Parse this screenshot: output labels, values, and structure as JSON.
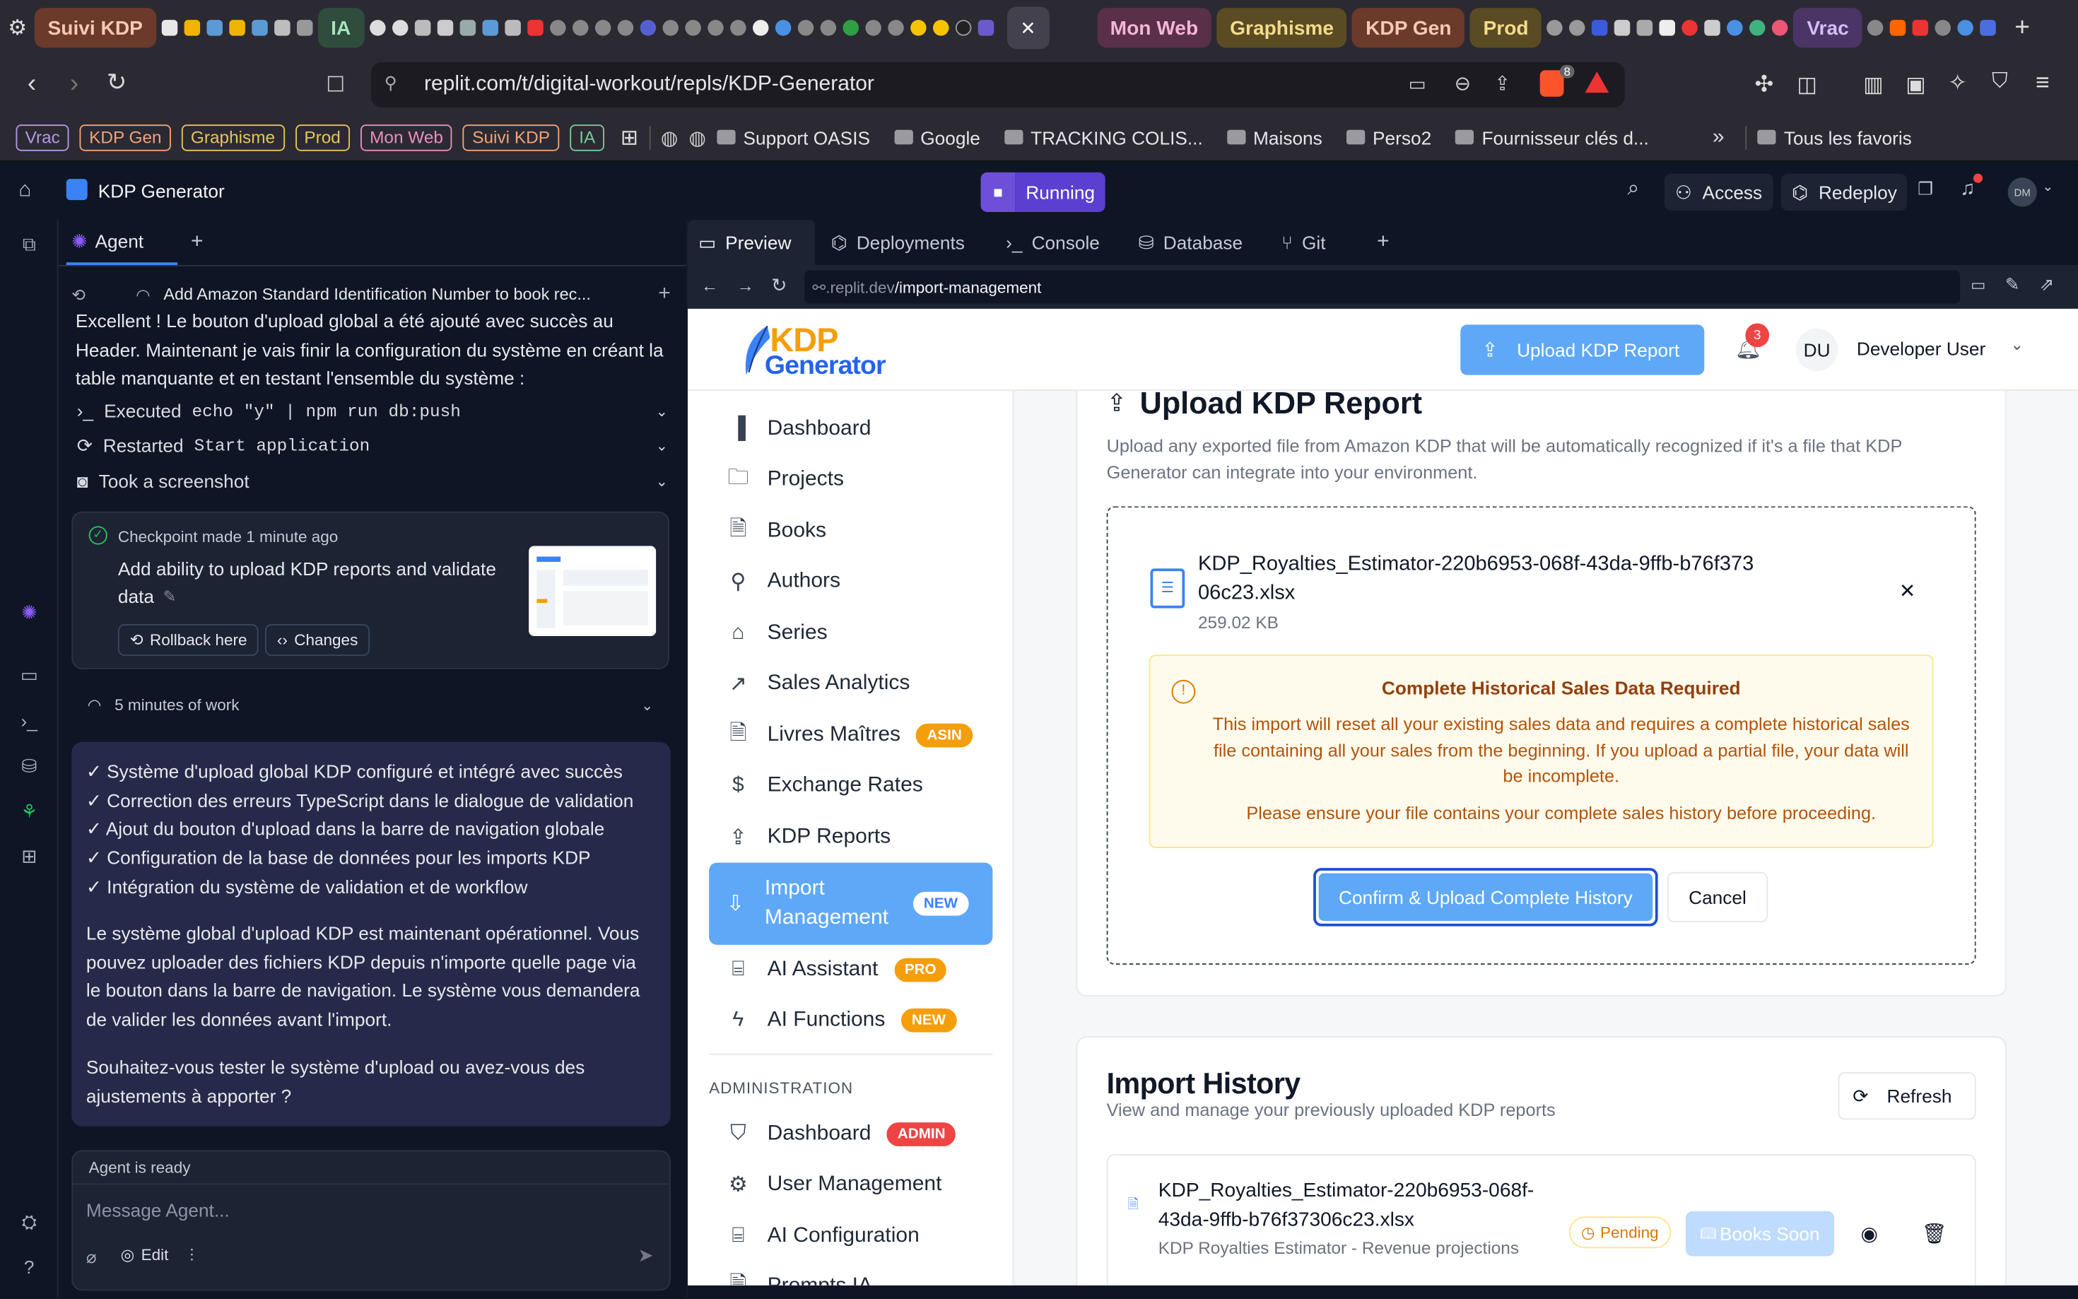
{
  "browser": {
    "tab_groups_left": [
      {
        "label": "Suivi KDP",
        "bg": "#6b3a2a",
        "fg": "#f7c9b5"
      },
      {
        "label": "IA",
        "bg": "#2f4d3c",
        "fg": "#a6e3bd"
      }
    ],
    "tab_groups_right": [
      {
        "label": "Mon Web",
        "bg": "#5a2f48",
        "fg": "#f3b6d7"
      },
      {
        "label": "Graphisme",
        "bg": "#5a4b22",
        "fg": "#f3db8d"
      },
      {
        "label": "KDP Gen",
        "bg": "#6b3a2a",
        "fg": "#f7c9b5"
      },
      {
        "label": "Prod",
        "bg": "#5a4b22",
        "fg": "#f3db8d"
      },
      {
        "label": "Vrac",
        "bg": "#4b3566",
        "fg": "#d4bdf5"
      }
    ],
    "url": "replit.com/t/digital-workout/repls/KDP-Generator",
    "bookmark_chips": [
      {
        "label": "Vrac",
        "color": "#b596e8"
      },
      {
        "label": "KDP Gen",
        "color": "#f0a37a"
      },
      {
        "label": "Graphisme",
        "color": "#e6c55a"
      },
      {
        "label": "Prod",
        "color": "#e6c55a"
      },
      {
        "label": "Mon Web",
        "color": "#e58fbf"
      },
      {
        "label": "Suivi KDP",
        "color": "#f0a37a"
      },
      {
        "label": "IA",
        "color": "#79c99a"
      }
    ],
    "bookmarks": [
      "Support OASIS",
      "Google",
      "TRACKING COLIS...",
      "Maisons",
      "Perso2",
      "Fournisseur clés d..."
    ],
    "all_bookmarks": "Tous les favoris",
    "shield_count": "8"
  },
  "replit": {
    "project_name": "KDP Generator",
    "run_status": "Running",
    "access_label": "Access",
    "redeploy_label": "Redeploy",
    "avatar_initials": "DM"
  },
  "agent": {
    "tab_label": "Agent",
    "thread_title": "Add Amazon Standard Identification Number to book rec...",
    "intro_text": "Excellent ! Le bouton d'upload global a été ajouté avec succès au Header. Maintenant je vais finir la configuration du système en créant la table manquante et en testant l'ensemble du système :",
    "tool_executed_prefix": "Executed",
    "tool_executed_cmd": "echo \"y\" | npm run db:push",
    "tool_restarted_prefix": "Restarted",
    "tool_restarted_cmd": "Start application",
    "tool_screenshot": "Took a screenshot",
    "checkpoint_meta": "Checkpoint made 1 minute ago",
    "checkpoint_title": "Add ability to upload KDP reports and validate data",
    "rollback_label": "Rollback here",
    "changes_label": "Changes",
    "work_duration": "5 minutes of work",
    "checklist": [
      "✓ Système d'upload global KDP configuré et intégré avec succès",
      "✓ Correction des erreurs TypeScript dans le dialogue de validation",
      "✓ Ajout du bouton d'upload dans la barre de navigation globale",
      "✓ Configuration de la base de données pour les imports KDP",
      "✓ Intégration du système de validation et de workflow"
    ],
    "summary_text": "Le système global d'upload KDP est maintenant opérationnel. Vous pouvez uploader des fichiers KDP depuis n'importe quelle page via le bouton dans la barre de navigation. Le système vous demandera de valider les données avant l'import.",
    "question_text": "Souhaitez-vous tester le système d'upload ou avez-vous des ajustements à apporter ?",
    "status": "Agent is ready",
    "input_placeholder": "Message Agent...",
    "edit_label": "Edit"
  },
  "workspace": {
    "tabs": [
      "Preview",
      "Deployments",
      "Console",
      "Database",
      "Git"
    ],
    "preview_url_prefix": ".replit.dev",
    "preview_url_path": "/import-management"
  },
  "app": {
    "logo_top": "KDP",
    "logo_bottom": "Generator",
    "upload_button": "Upload KDP Report",
    "notification_count": "3",
    "user_initials": "DU",
    "user_name": "Developer User",
    "nav": [
      {
        "label": "Dashboard",
        "icon": "bar-chart-icon"
      },
      {
        "label": "Projects",
        "icon": "folder-icon"
      },
      {
        "label": "Books",
        "icon": "file-icon"
      },
      {
        "label": "Authors",
        "icon": "user-icon"
      },
      {
        "label": "Series",
        "icon": "tag-icon"
      },
      {
        "label": "Sales Analytics",
        "icon": "trending-up-icon"
      },
      {
        "label": "Livres Maîtres",
        "icon": "file-icon",
        "badge": "ASIN",
        "badge_color": "#f59e0b"
      },
      {
        "label": "Exchange Rates",
        "icon": "dollar-icon"
      },
      {
        "label": "KDP Reports",
        "icon": "upload-icon"
      },
      {
        "label": "Import Management",
        "icon": "download-icon",
        "badge": "NEW",
        "badge_color": "#ffffff",
        "active": true
      },
      {
        "label": "AI Assistant",
        "icon": "bot-icon",
        "badge": "PRO",
        "badge_color": "#f59e0b"
      },
      {
        "label": "AI Functions",
        "icon": "zap-icon",
        "badge": "NEW",
        "badge_color": "#f59e0b"
      }
    ],
    "admin_heading": "ADMINISTRATION",
    "admin_nav": [
      {
        "label": "Dashboard",
        "icon": "shield-icon",
        "badge": "ADMIN",
        "badge_color": "#ef4444"
      },
      {
        "label": "User Management",
        "icon": "gear-icon"
      },
      {
        "label": "AI Configuration",
        "icon": "bot-icon"
      },
      {
        "label": "Prompts IA",
        "icon": "file-icon"
      }
    ],
    "upload_section": {
      "title": "Upload KDP Report",
      "description": "Upload any exported file from Amazon KDP that will be automatically recognized if it's a file that KDP Generator can integrate into your environment.",
      "file_name": "KDP_Royalties_Estimator-220b6953-068f-43da-9ffb-b76f37306c23.xlsx",
      "file_size": "259.02 KB",
      "warning_title": "Complete Historical Sales Data Required",
      "warning_body": "This import will reset all your existing sales data and requires a complete historical sales file containing all your sales from the beginning. If you upload a partial file, your data will be incomplete.",
      "warning_note": "Please ensure your file contains your complete sales history before proceeding.",
      "confirm_label": "Confirm & Upload Complete History",
      "cancel_label": "Cancel"
    },
    "history_section": {
      "title": "Import History",
      "subtitle": "View and manage your previously uploaded KDP reports",
      "refresh_label": "Refresh",
      "items": [
        {
          "file_name": "KDP_Royalties_Estimator-220b6953-068f-43da-9ffb-b76f37306c23.xlsx",
          "description": "KDP Royalties Estimator - Revenue projections",
          "status": "Pending",
          "action": "Books Soon"
        }
      ]
    }
  }
}
